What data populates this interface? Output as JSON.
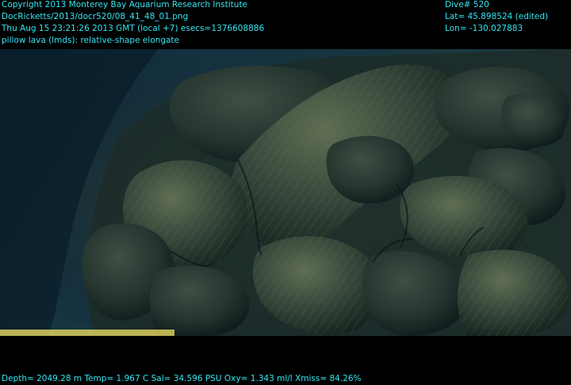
{
  "colors": {
    "overlay_text": "#34e6f2",
    "water_deep": "#0d2536",
    "water_mid": "#1a3a47",
    "lava_dark": "#1e2a24",
    "lava_light": "#4a5c46",
    "lava_highlight": "#7d8a63",
    "laser_bar": "#d8cc5a"
  },
  "overlay": {
    "copyright": "Copyright 2013 Monterey Bay Aquarium Research Institute",
    "file_path": "DocRicketts/2013/docr520/08_41_48_01.png",
    "timestamp": "Thu Aug 15 23:21:26 2013 GMT (local +7)  esecs=1376608886",
    "annotation": "pillow lava (lmds): relative-shape elongate",
    "dive": "Dive# 520",
    "latitude": "Lat= 45.898524 (edited)",
    "longitude": "Lon= -130.027883",
    "sensors": "Depth= 2049.28 m  Temp= 1.967 C  Sal= 34.596 PSU  Oxy= 1.343 ml/l  Xmiss= 84.26%"
  }
}
